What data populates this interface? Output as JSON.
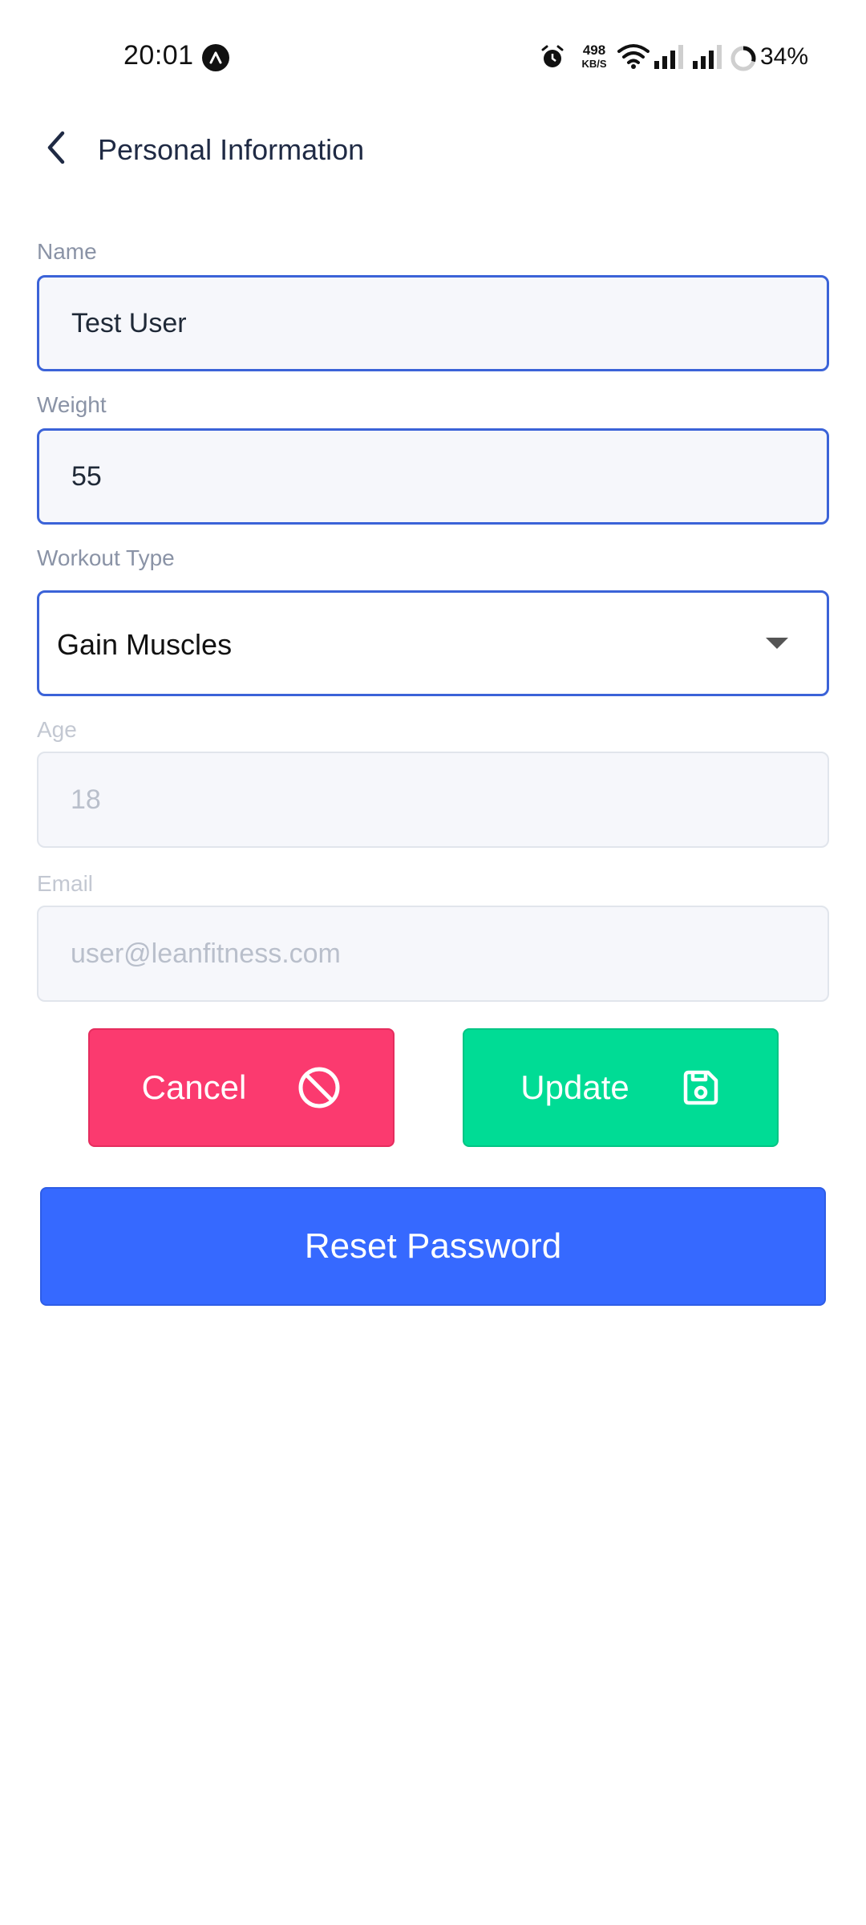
{
  "status_bar": {
    "time": "20:01",
    "net_speed_value": "498",
    "net_speed_unit": "KB/S",
    "battery": "34%",
    "icons": [
      "app-notification-icon",
      "alarm-icon",
      "wifi-icon",
      "signal-icon",
      "signal-icon",
      "battery-ring-icon"
    ]
  },
  "header": {
    "back_icon": "chevron-left-icon",
    "title": "Personal Information"
  },
  "form": {
    "name": {
      "label": "Name",
      "value": "Test User"
    },
    "weight": {
      "label": "Weight",
      "value": "55"
    },
    "workout_type": {
      "label": "Workout Type",
      "selected": "Gain Muscles"
    },
    "age": {
      "label": "Age",
      "placeholder": "18"
    },
    "email": {
      "label": "Email",
      "placeholder": "user@leanfitness.com"
    }
  },
  "actions": {
    "cancel_label": "Cancel",
    "cancel_icon": "block-icon",
    "update_label": "Update",
    "update_icon": "save-icon",
    "reset_label": "Reset Password"
  },
  "colors": {
    "accent": "#3b63d8",
    "cancel": "#fb3a6f",
    "update": "#00dc95",
    "reset": "#3669ff"
  }
}
